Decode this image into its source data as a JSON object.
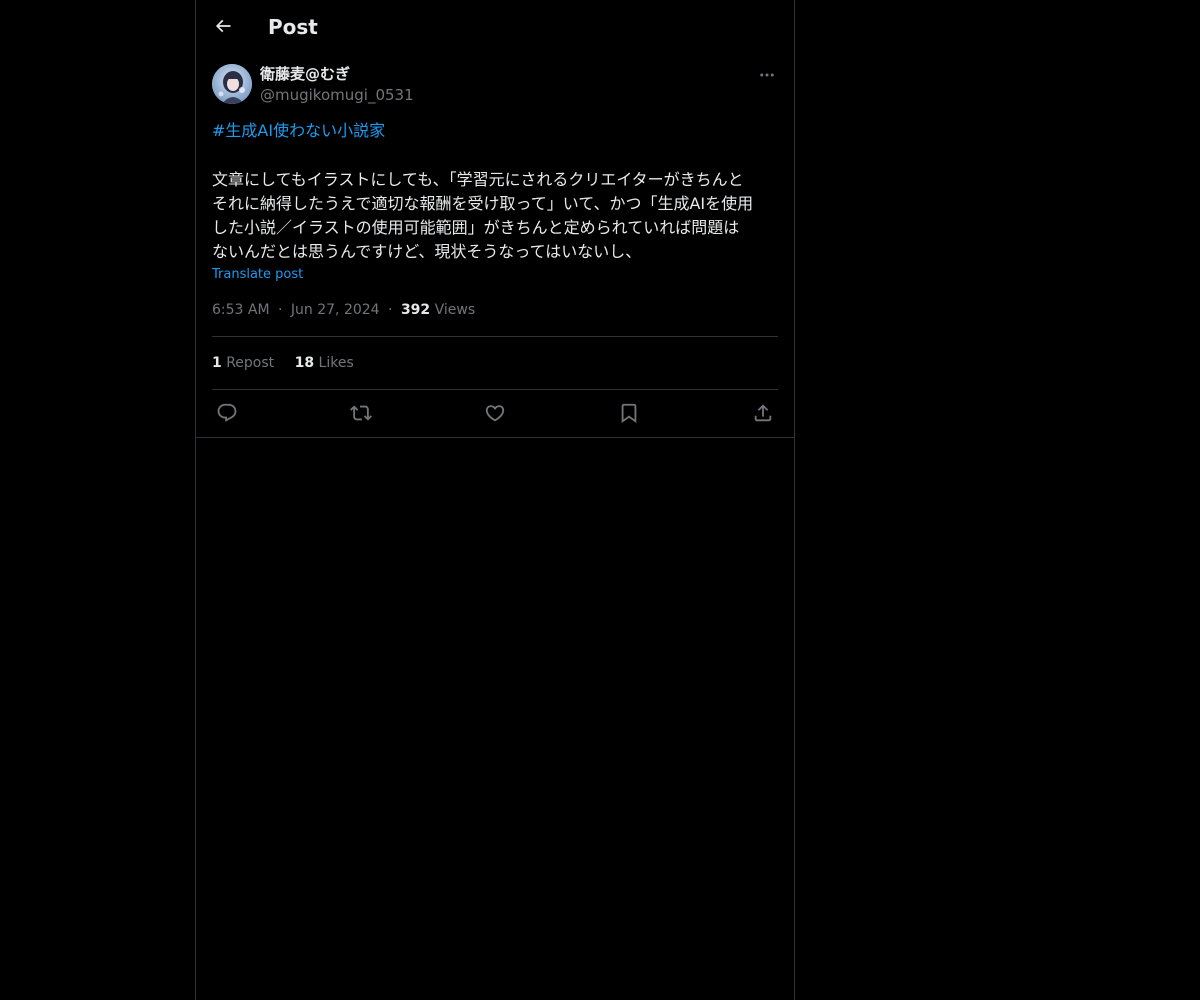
{
  "header": {
    "title": "Post",
    "back_icon": "arrow-left-icon"
  },
  "post": {
    "author": {
      "display_name": "衛藤麦@むぎ",
      "handle": "@mugikomugi_0531"
    },
    "hashtag": "#生成AI使わない小説家",
    "body_lines": [
      "文章にしてもイラストにしても、「学習元にされるクリエイターがきちんと",
      "それに納得したうえで適切な報酬を受け取って」いて、かつ「生成AIを使用",
      "した小説／イラストの使用可能範囲」がきちんと定められていれば問題は",
      "ないんだとは思うんですけど、現状そうなってはいないし、"
    ],
    "translate_label": "Translate post",
    "time": "6:53 AM",
    "date": "Jun 27, 2024",
    "separator": "·",
    "views_count": "392",
    "views_label": "Views",
    "reposts_count": "1",
    "reposts_label": "Repost",
    "likes_count": "18",
    "likes_label": "Likes"
  },
  "actions": [
    "reply-icon",
    "repost-icon",
    "like-icon",
    "bookmark-icon",
    "share-icon"
  ],
  "colors": {
    "background": "#000000",
    "text": "#e7e9ea",
    "secondary": "#71767b",
    "link": "#1d9bf0",
    "border": "#2f3336"
  }
}
